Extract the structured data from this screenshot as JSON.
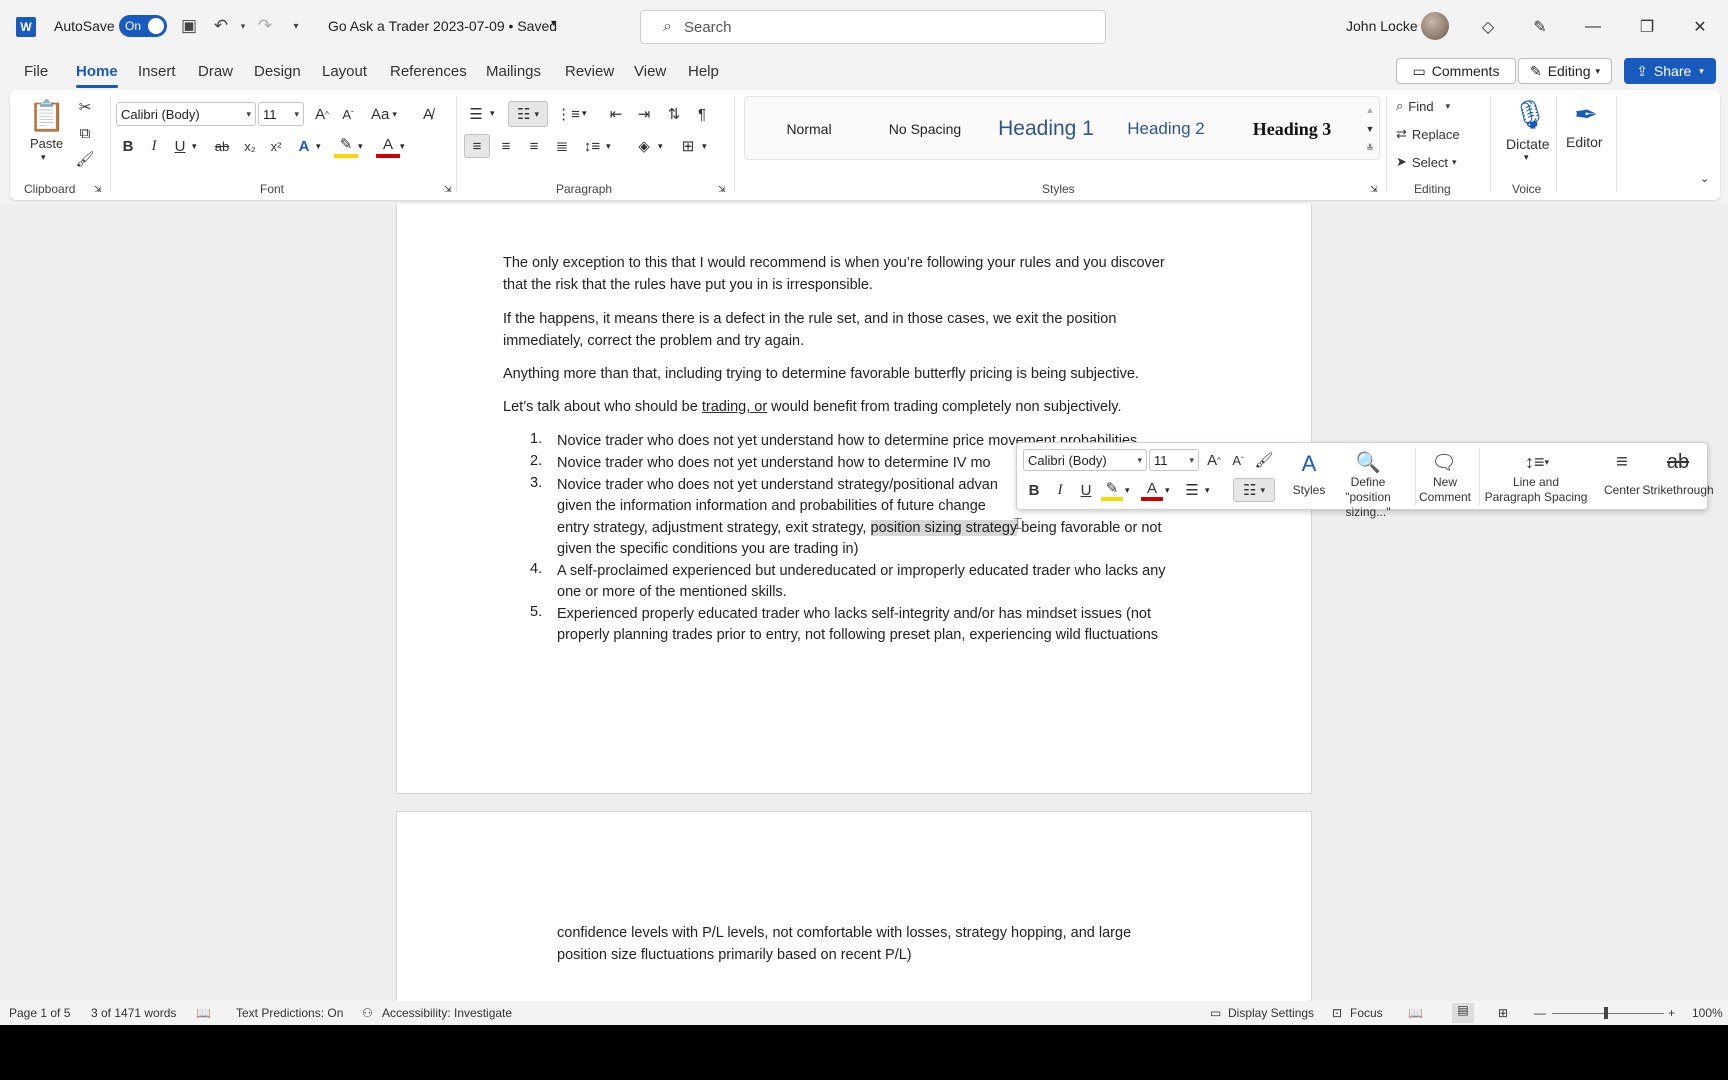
{
  "app": {
    "logo": "W",
    "autosave_label": "AutoSave",
    "autosave_state": "On",
    "doc_title": "Go Ask a Trader 2023-07-09 • Saved",
    "search_placeholder": "Search",
    "user_name": "John Locke"
  },
  "tabs": [
    "File",
    "Home",
    "Insert",
    "Draw",
    "Design",
    "Layout",
    "References",
    "Mailings",
    "Review",
    "View",
    "Help"
  ],
  "top_right": {
    "comments": "Comments",
    "editing": "Editing",
    "share": "Share"
  },
  "ribbon": {
    "clipboard": {
      "paste": "Paste",
      "label": "Clipboard"
    },
    "font": {
      "family": "Calibri (Body)",
      "size": "11",
      "label": "Font",
      "bold": "B",
      "italic": "I",
      "underline": "U",
      "strike": "ab",
      "subscript": "x₂",
      "superscript": "x²",
      "font_color_letter": "A",
      "case": "Aa",
      "grow": "A",
      "shrink": "A"
    },
    "paragraph": {
      "label": "Paragraph"
    },
    "styles": {
      "label": "Styles",
      "items": [
        "Normal",
        "No Spacing",
        "Heading 1",
        "Heading 2",
        "Heading 3"
      ]
    },
    "editing": {
      "find": "Find",
      "replace": "Replace",
      "select": "Select",
      "label": "Editing"
    },
    "voice": {
      "dictate": "Dictate",
      "label": "Voice"
    },
    "editor": {
      "label": "Editor"
    }
  },
  "document": {
    "paragraphs": [
      "The only exception to this that I would recommend is when you’re following your rules and you discover",
      "that the risk that the rules have put you in is irresponsible.",
      "If the happens, it means there is a defect in the rule set, and in those cases, we exit the position",
      "immediately, correct the problem and try again.",
      "Anything more than that, including trying to determine favorable butterfly pricing is being subjective."
    ],
    "lets_talk": {
      "before": "Let’s talk about who should be ",
      "underlined": "trading, or",
      "after": " would benefit from trading completely non subjectively."
    },
    "list": [
      {
        "num": "1.",
        "lines": [
          "Novice trader who does not yet understand how to determine price movement probabilities"
        ]
      },
      {
        "num": "2.",
        "lines": [
          "Novice trader who does not yet understand how to determine IV mo"
        ]
      },
      {
        "num": "3.",
        "lines": [
          "Novice trader who does not yet understand strategy/positional advan",
          "given the information information and probabilities of future change",
          "entry strategy, adjustment strategy, exit strategy, ",
          "given the specific conditions you are trading in)"
        ]
      },
      {
        "num": "4.",
        "lines": [
          "A self-proclaimed experienced but undereducated or improperly educated trader who lacks any",
          "one or more of the mentioned skills."
        ]
      },
      {
        "num": "5.",
        "lines": [
          "Experienced properly educated trader who lacks self-integrity and/or has mindset issues (not",
          "properly planning trades prior to entry, not following preset plan, experiencing wild fluctuations"
        ]
      }
    ],
    "selected_text": "position sizing strategy",
    "after_selected": " being favorable or not",
    "page2_lines": [
      "confidence levels with P/L levels, not comfortable with losses, strategy hopping, and large",
      "position size fluctuations primarily based on recent P/L)"
    ]
  },
  "mini_toolbar": {
    "font": "Calibri (Body)",
    "size": "11",
    "styles": "Styles",
    "define_line1": "Define \"position",
    "define_line2": "sizing...\"",
    "new_comment_line1": "New",
    "new_comment_line2": "Comment",
    "spacing_line1": "Line and",
    "spacing_line2": "Paragraph Spacing",
    "center": "Center",
    "strikethrough": "Strikethrough",
    "strike_glyph": "ab"
  },
  "status": {
    "page": "Page 1 of 5",
    "words": "3 of 1471 words",
    "predictions": "Text Predictions: On",
    "accessibility": "Accessibility: Investigate",
    "display": "Display Settings",
    "focus": "Focus",
    "zoom": "100%"
  },
  "colors": {
    "accent": "#185abd",
    "highlight": "#ffd700",
    "font_red": "#d00000"
  }
}
